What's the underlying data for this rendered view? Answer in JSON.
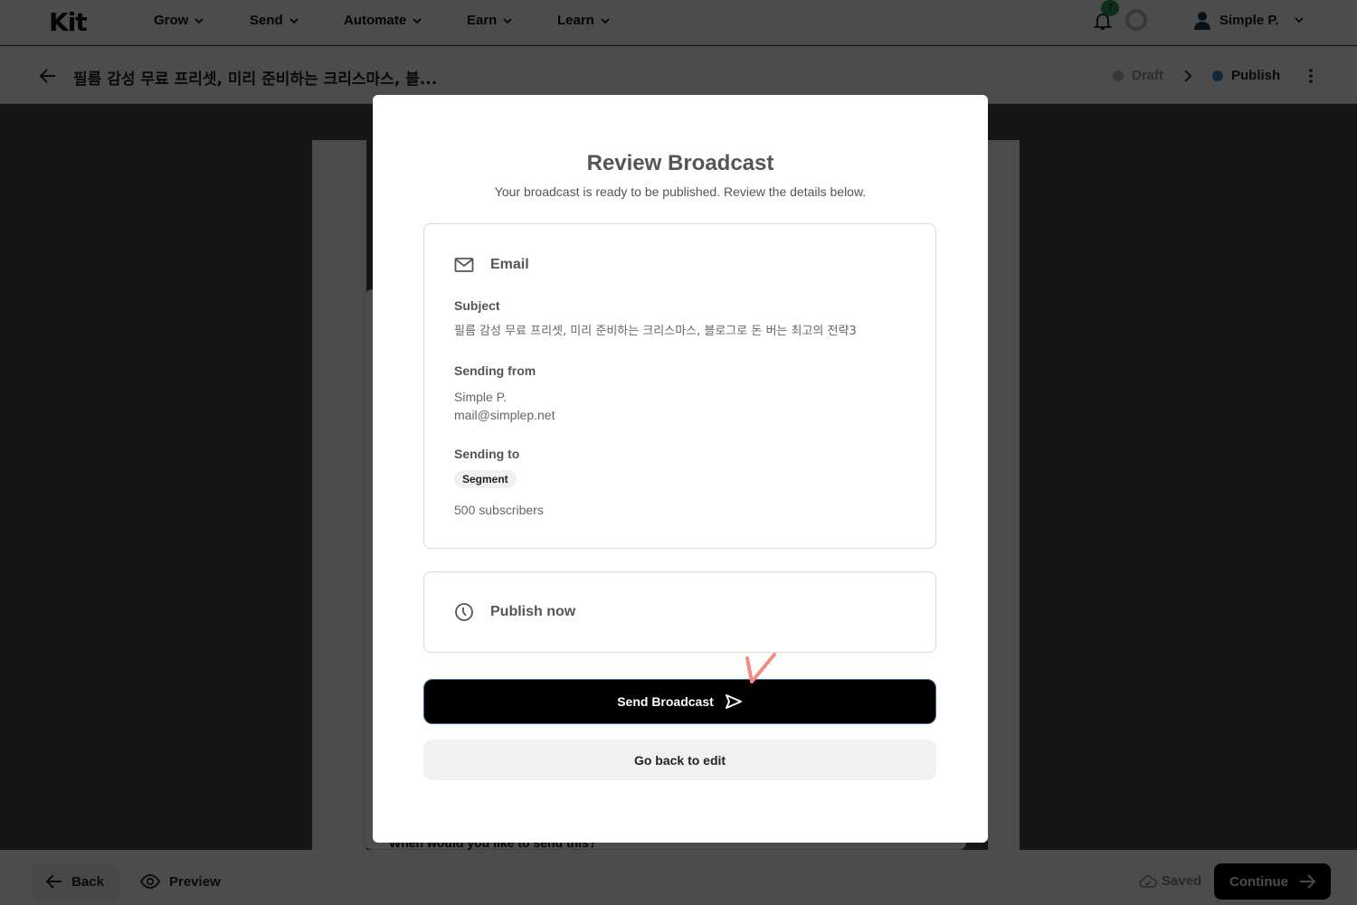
{
  "topnav": {
    "logo": "Kit",
    "items": [
      {
        "label": "Grow"
      },
      {
        "label": "Send"
      },
      {
        "label": "Automate"
      },
      {
        "label": "Earn"
      },
      {
        "label": "Learn"
      }
    ],
    "notification_count": "7",
    "account_name": "Simple P."
  },
  "subheader": {
    "title": "필름 감성 무료 프리셋, 미리 준비하는 크리스마스, 블...",
    "steps": [
      {
        "label": "Draft",
        "state": "inactive",
        "color": "#bdbdbd"
      },
      {
        "label": "Publish",
        "state": "active",
        "color": "#3b82c4"
      }
    ]
  },
  "background": {
    "question": "When would you like to send this?"
  },
  "footer": {
    "back_label": "Back",
    "preview_label": "Preview",
    "saved_label": "Saved",
    "continue_label": "Continue"
  },
  "modal": {
    "title": "Review Broadcast",
    "subtitle": "Your broadcast is ready to be published. Review the details below.",
    "email_card": {
      "heading": "Email",
      "subject_label": "Subject",
      "subject_value": "필름 감성 무료 프리셋, 미리 준비하는 크리스마스, 블로그로 돈 버는 최고의 전략3",
      "from_label": "Sending from",
      "from_name": "Simple P.",
      "from_email": "mail@simplep.net",
      "to_label": "Sending to",
      "to_tag": "Segment",
      "to_count": "500 subscribers"
    },
    "schedule_card": {
      "heading": "Publish now"
    },
    "send_label": "Send Broadcast",
    "edit_label": "Go back to edit"
  },
  "annotation": {
    "color": "#f28b82",
    "icon": "checkmark-annotation"
  }
}
